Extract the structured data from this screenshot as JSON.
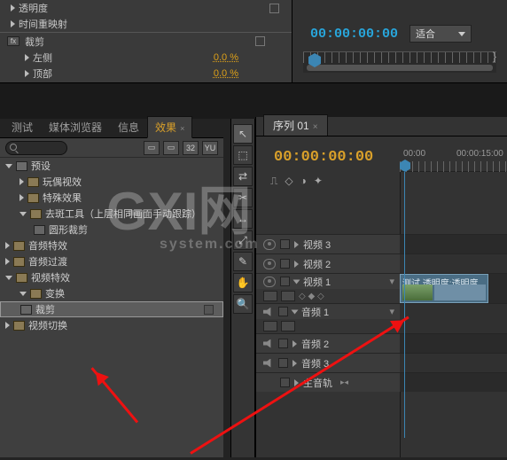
{
  "effectControls": {
    "rows": [
      {
        "label": "透明度"
      },
      {
        "label": "时间重映射"
      }
    ],
    "fxHeader": "裁剪",
    "params": [
      {
        "label": "左侧",
        "value": "0.0 %"
      },
      {
        "label": "顶部",
        "value": "0.0 %"
      }
    ]
  },
  "programMonitor": {
    "timecode": "00:00:00:00",
    "fit": "适合"
  },
  "projectTabs": {
    "items": [
      "测试",
      "媒体浏览器",
      "信息",
      "效果"
    ],
    "activeIndex": 3
  },
  "effectsToolbar": {
    "btn32": "32",
    "btnYUV": "YU"
  },
  "effectsTree": [
    {
      "l": 1,
      "t": "preset",
      "label": "预设"
    },
    {
      "l": 2,
      "t": "folder",
      "label": "玩偶视效"
    },
    {
      "l": 2,
      "t": "folder",
      "label": "特殊效果"
    },
    {
      "l": 2,
      "t": "folder",
      "label": "去斑工具（上层相同画面手动跟踪）"
    },
    {
      "l": 3,
      "t": "preset",
      "label": "圆形裁剪"
    },
    {
      "l": 1,
      "t": "folder",
      "label": "音频特效"
    },
    {
      "l": 1,
      "t": "folder",
      "label": "音频过渡"
    },
    {
      "l": 1,
      "t": "folder",
      "label": "视频特效"
    },
    {
      "l": 2,
      "t": "folder",
      "label": "变换"
    },
    {
      "l": 2,
      "t": "preset",
      "label": "裁剪",
      "sel": true
    },
    {
      "l": 1,
      "t": "folder",
      "label": "视频切换"
    }
  ],
  "tools": [
    "↖",
    "⬚",
    "⇄",
    "✂",
    "↔",
    "⤢",
    "✎",
    "✋",
    "🔍"
  ],
  "sequence": {
    "tabLabel": "序列 01",
    "timecode": "00:00:00:00",
    "rulerLabels": [
      "00:00",
      "00:00:15:00"
    ],
    "tracks": {
      "v3": "视频 3",
      "v2": "视频 2",
      "v1": "视频 1",
      "a1": "音频 1",
      "a2": "音频 2",
      "a3": "音频 3",
      "master": "主音轨"
    },
    "clipLabel": "测试 透明度:透明度"
  }
}
